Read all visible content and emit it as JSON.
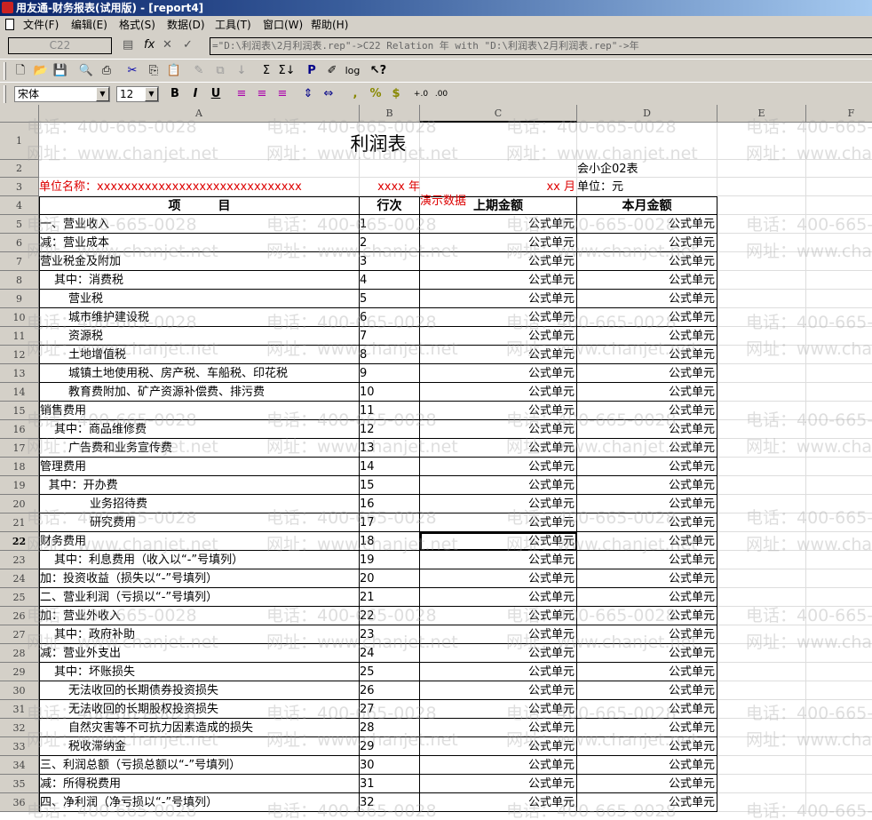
{
  "window": {
    "title": "用友通-财务报表(试用版) - [report4]"
  },
  "menu": [
    "文件(F)",
    "编辑(E)",
    "格式(S)",
    "数据(D)",
    "工具(T)",
    "窗口(W)",
    "帮助(H)"
  ],
  "formula_bar": {
    "cell_ref": "C22",
    "formula": "=\"D:\\利润表\\2月利润表.rep\"->C22 Relation 年 with \"D:\\利润表\\2月利润表.rep\"->年"
  },
  "font": {
    "name": "宋体",
    "size": "12"
  },
  "columns": [
    "A",
    "B",
    "C",
    "D",
    "E",
    "F"
  ],
  "sheet": {
    "title": "利润表",
    "form_no": "会小企02表",
    "unit_name": "单位名称：xxxxxxxxxxxxxxxxxxxxxxxxxxxxxx",
    "year": "xxxx 年",
    "month": "xx 月",
    "currency": "单位：元",
    "demo": "演示数据",
    "headers": [
      "项　　　目",
      "行次",
      "上期金额",
      "本月金额"
    ],
    "formula_text": "公式单元",
    "rows": [
      {
        "label": "一、营业收入",
        "no": "1",
        "ind": 0
      },
      {
        "label": "减：营业成本",
        "no": "2",
        "ind": 0
      },
      {
        "label": "营业税金及附加",
        "no": "3",
        "ind": 0
      },
      {
        "label": "其中：消费税",
        "no": "4",
        "ind": 1
      },
      {
        "label": "营业税",
        "no": "5",
        "ind": 2
      },
      {
        "label": "城市维护建设税",
        "no": "6",
        "ind": 2
      },
      {
        "label": "资源税",
        "no": "7",
        "ind": 2
      },
      {
        "label": "土地增值税",
        "no": "8",
        "ind": 2
      },
      {
        "label": "城镇土地使用税、房产税、车船税、印花税",
        "no": "9",
        "ind": 2
      },
      {
        "label": "教育费附加、矿产资源补偿费、排污费",
        "no": "10",
        "ind": 2
      },
      {
        "label": "销售费用",
        "no": "11",
        "ind": 0
      },
      {
        "label": "其中：商品维修费",
        "no": "12",
        "ind": 1
      },
      {
        "label": "广告费和业务宣传费",
        "no": "13",
        "ind": 2
      },
      {
        "label": "管理费用",
        "no": "14",
        "ind": 0
      },
      {
        "label": "其中：开办费",
        "no": "15",
        "ind": 0.6
      },
      {
        "label": "业务招待费",
        "no": "16",
        "ind": 3.5
      },
      {
        "label": "研究费用",
        "no": "17",
        "ind": 3.5
      },
      {
        "label": "财务费用",
        "no": "18",
        "ind": 0
      },
      {
        "label": "其中：利息费用（收入以“-”号填列）",
        "no": "19",
        "ind": 1
      },
      {
        "label": "加：投资收益（损失以“-”号填列）",
        "no": "20",
        "ind": 0
      },
      {
        "label": "二、营业利润（亏损以“-”号填列）",
        "no": "21",
        "ind": 0
      },
      {
        "label": "加：营业外收入",
        "no": "22",
        "ind": 0
      },
      {
        "label": "其中：政府补助",
        "no": "23",
        "ind": 1
      },
      {
        "label": "减：营业外支出",
        "no": "24",
        "ind": 0
      },
      {
        "label": "其中：坏账损失",
        "no": "25",
        "ind": 1
      },
      {
        "label": "无法收回的长期债券投资损失",
        "no": "26",
        "ind": 2
      },
      {
        "label": "无法收回的长期股权投资损失",
        "no": "27",
        "ind": 2
      },
      {
        "label": "自然灾害等不可抗力因素造成的损失",
        "no": "28",
        "ind": 2
      },
      {
        "label": "税收滞纳金",
        "no": "29",
        "ind": 2
      },
      {
        "label": "三、利润总额（亏损总额以“-”号填列）",
        "no": "30",
        "ind": 0
      },
      {
        "label": "减：所得税费用",
        "no": "31",
        "ind": 0
      },
      {
        "label": "四、净利润（净亏损以“-”号填列）",
        "no": "32",
        "ind": 0
      }
    ]
  },
  "watermark": {
    "phone": "电话：400-665-0028",
    "site": "网址：www.chanjet.net"
  }
}
